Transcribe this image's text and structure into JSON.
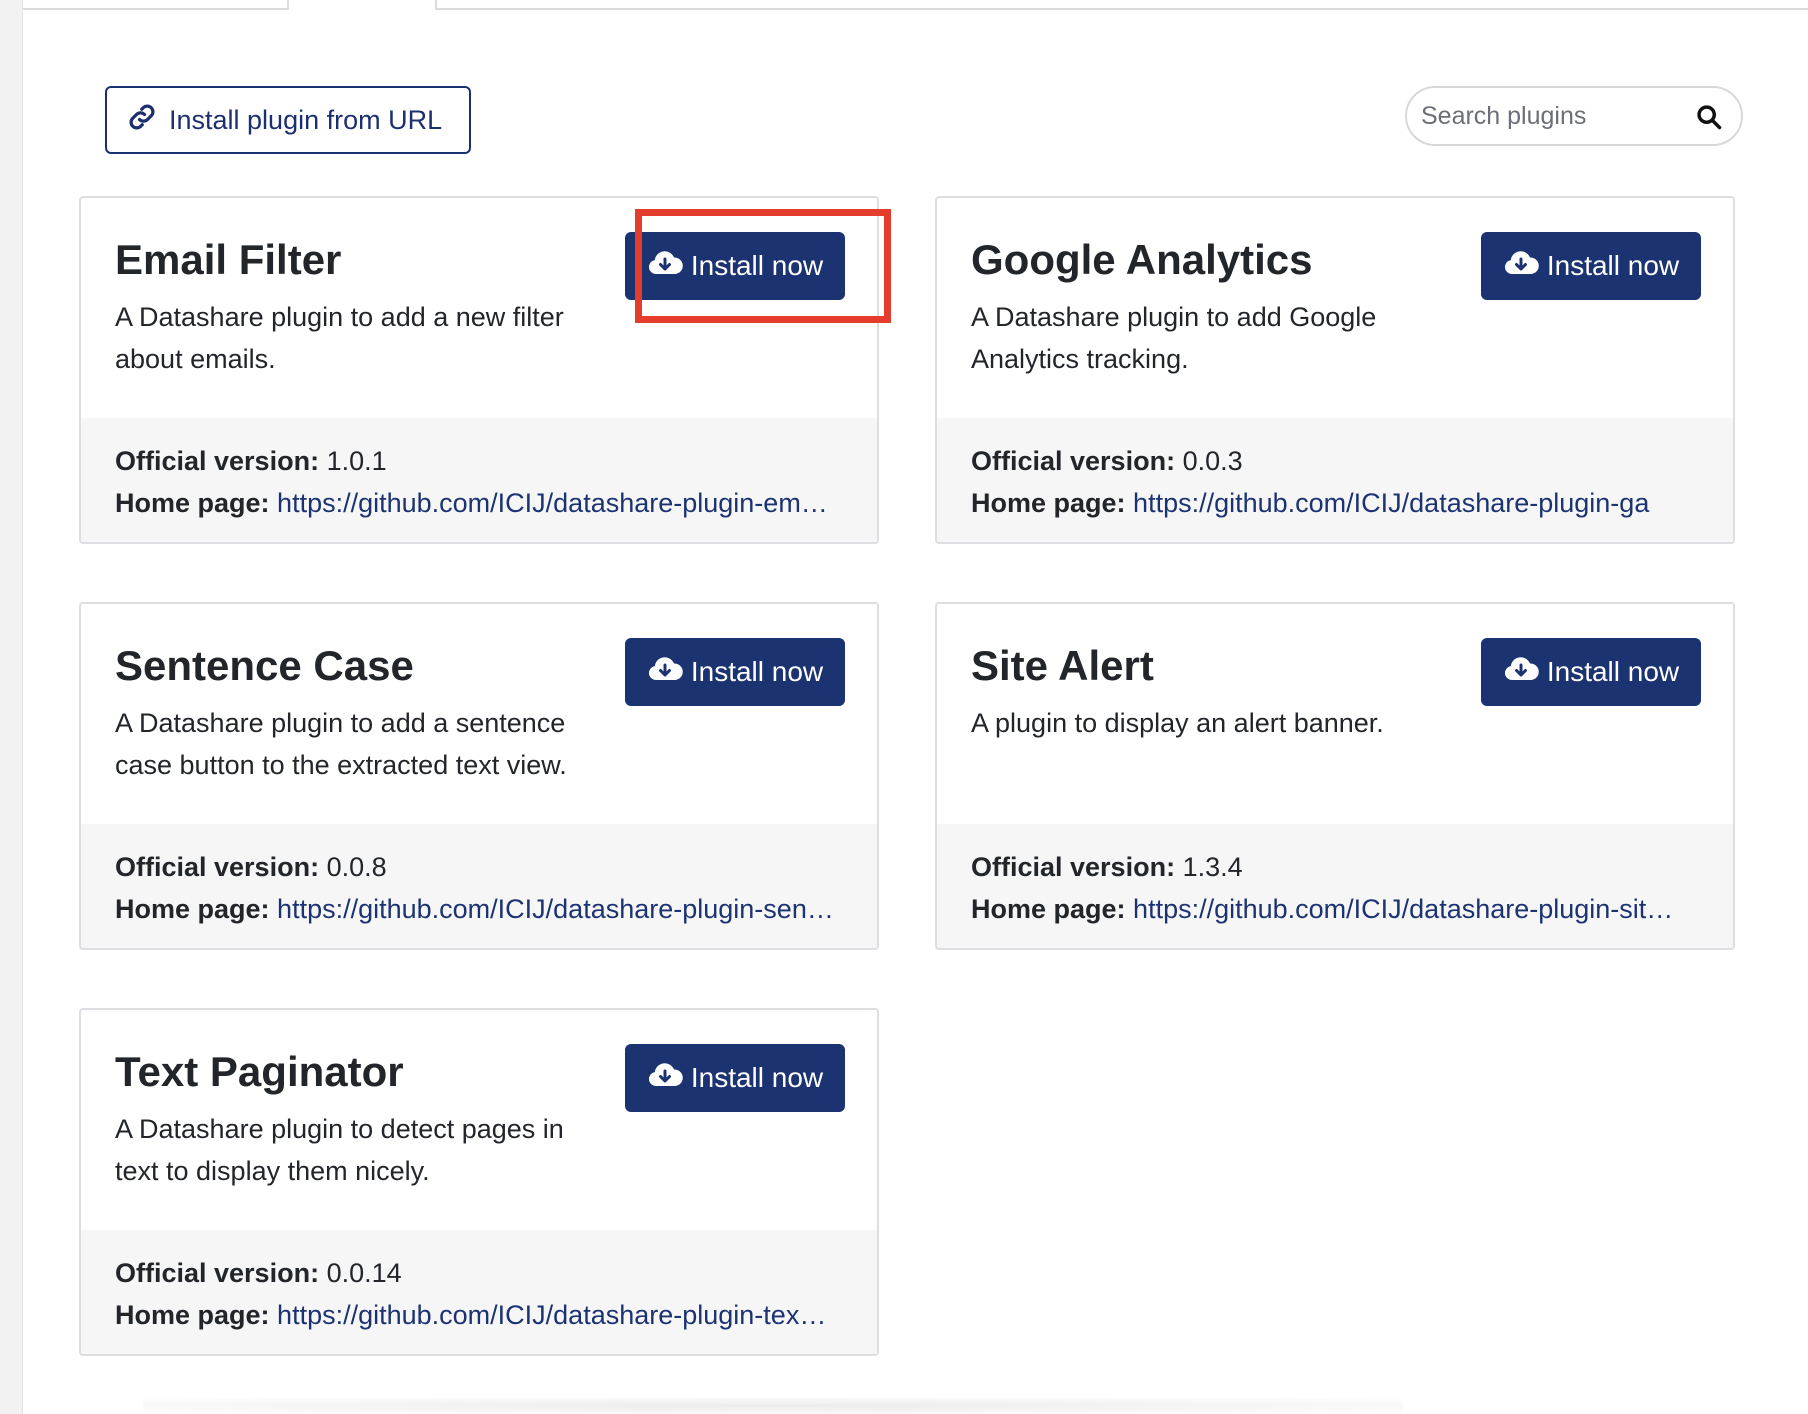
{
  "toolbar": {
    "install_from_url_label": "Install plugin from URL",
    "search_placeholder": "Search plugins"
  },
  "icons": {
    "link": "link-icon",
    "search": "search-icon",
    "install": "cloud-download-icon"
  },
  "colors": {
    "primary": "#1c3372",
    "highlight": "#e53d2b"
  },
  "labels": {
    "official_version": "Official version:",
    "home_page": "Home page:"
  },
  "plugins": [
    {
      "title": "Email Filter",
      "description": "A Datashare plugin to add a new filter about emails.",
      "install_label": "Install now",
      "version": "1.0.1",
      "home_page": "https://github.com/ICIJ/datashare-plugin-em…"
    },
    {
      "title": "Google Analytics",
      "description": "A Datashare plugin to add Google Analytics tracking.",
      "install_label": "Install now",
      "version": "0.0.3",
      "home_page": "https://github.com/ICIJ/datashare-plugin-ga"
    },
    {
      "title": "Sentence Case",
      "description": "A Datashare plugin to add a sentence case button to the extracted text view.",
      "install_label": "Install now",
      "version": "0.0.8",
      "home_page": "https://github.com/ICIJ/datashare-plugin-sen…"
    },
    {
      "title": "Site Alert",
      "description": "A plugin to display an alert banner.",
      "install_label": "Install now",
      "version": "1.3.4",
      "home_page": "https://github.com/ICIJ/datashare-plugin-sit…"
    },
    {
      "title": "Text Paginator",
      "description": "A Datashare plugin to detect pages in text to display them nicely.",
      "install_label": "Install now",
      "version": "0.0.14",
      "home_page": "https://github.com/ICIJ/datashare-plugin-tex…"
    }
  ]
}
